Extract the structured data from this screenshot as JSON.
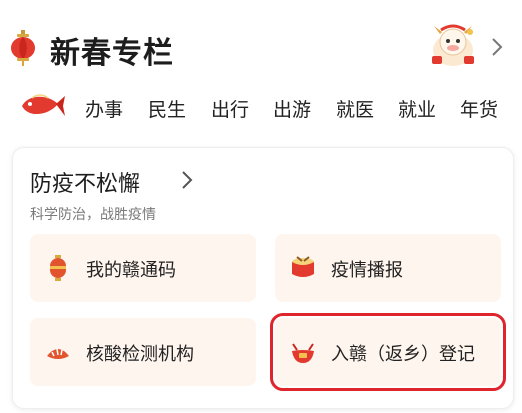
{
  "header": {
    "title": "新春专栏"
  },
  "categories": [
    "办事",
    "民生",
    "出行",
    "出游",
    "就医",
    "就业",
    "年货"
  ],
  "card": {
    "title": "防疫不松懈",
    "subtitle": "科学防治，战胜疫情",
    "tiles": [
      {
        "label": "我的赣通码",
        "icon": "lantern-capsule-icon"
      },
      {
        "label": "疫情播报",
        "icon": "drum-icon"
      },
      {
        "label": "核酸检测机构",
        "icon": "dumpling-icon"
      },
      {
        "label": "入赣（返乡）登记",
        "icon": "bowl-icon",
        "highlighted": true
      }
    ]
  },
  "colors": {
    "accent_red": "#e0242b",
    "tile_bg": "#fff5ef"
  }
}
